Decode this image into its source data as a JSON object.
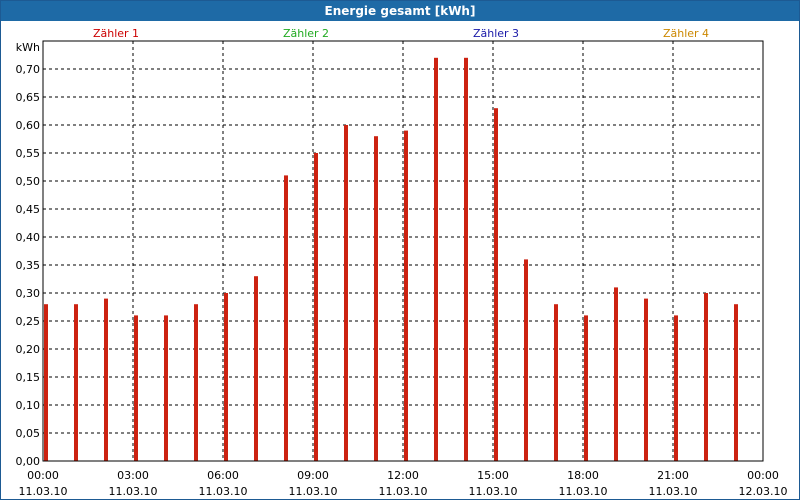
{
  "window": {
    "title": "Energie gesamt [kWh]"
  },
  "chart_data": {
    "type": "bar",
    "ylabel": "kWh",
    "ylim": [
      0,
      0.75
    ],
    "yticks": [
      "0,00",
      "0,05",
      "0,10",
      "0,15",
      "0,20",
      "0,25",
      "0,30",
      "0,35",
      "0,40",
      "0,45",
      "0,50",
      "0,55",
      "0,60",
      "0,65",
      "0,70"
    ],
    "xticks": [
      {
        "time": "00:00",
        "date": "11.03.10"
      },
      {
        "time": "03:00",
        "date": "11.03.10"
      },
      {
        "time": "06:00",
        "date": "11.03.10"
      },
      {
        "time": "09:00",
        "date": "11.03.10"
      },
      {
        "time": "12:00",
        "date": "11.03.10"
      },
      {
        "time": "15:00",
        "date": "11.03.10"
      },
      {
        "time": "18:00",
        "date": "11.03.10"
      },
      {
        "time": "21:00",
        "date": "11.03.10"
      },
      {
        "time": "00:00",
        "date": "12.03.10"
      }
    ],
    "legend": [
      {
        "name": "Zähler 1",
        "color": "#cc0000"
      },
      {
        "name": "Zähler 2",
        "color": "#22aa22"
      },
      {
        "name": "Zähler 3",
        "color": "#1a1aa8"
      },
      {
        "name": "Zähler 4",
        "color": "#cc8800"
      }
    ],
    "grid": true,
    "series": [
      {
        "name": "Zähler 1",
        "color": "#cc2211",
        "values": [
          0.28,
          0.28,
          0.29,
          0.26,
          0.26,
          0.28,
          0.3,
          0.33,
          0.51,
          0.55,
          0.6,
          0.58,
          0.59,
          0.72,
          0.72,
          0.63,
          0.36,
          0.28,
          0.26,
          0.31,
          0.29,
          0.26,
          0.3,
          0.28
        ]
      }
    ]
  }
}
